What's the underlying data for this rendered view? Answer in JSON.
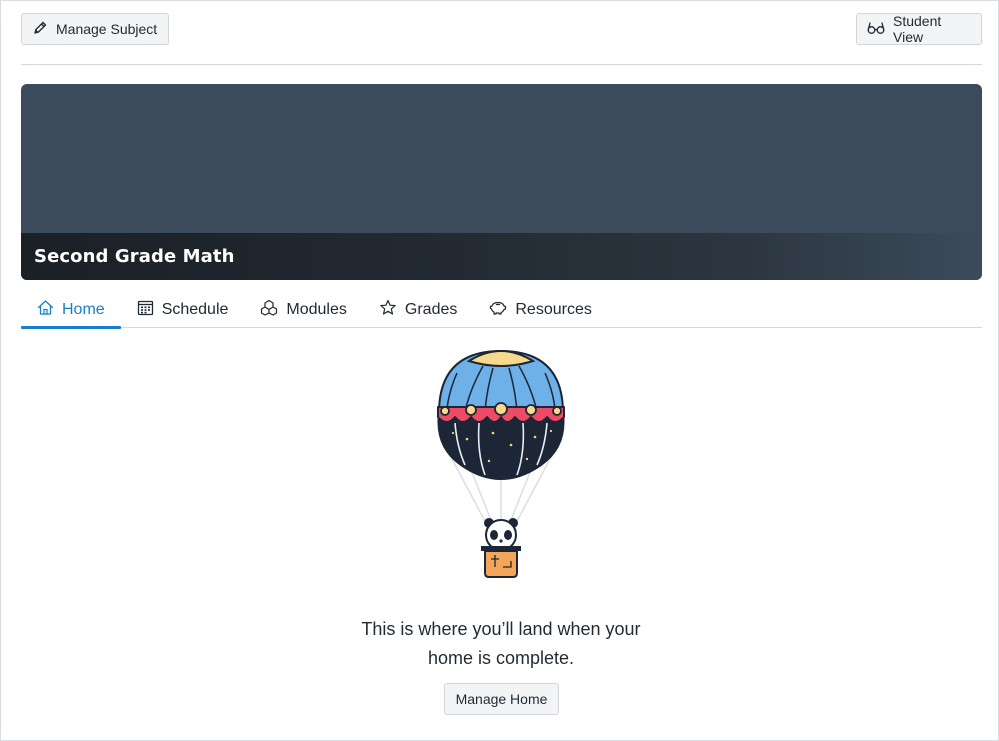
{
  "toolbar": {
    "manage_subject_label": "Manage Subject",
    "student_view_label": "Student View"
  },
  "banner": {
    "title": "Second Grade Math",
    "background_color": "#3b4b5b"
  },
  "tabs": [
    {
      "label": "Home",
      "icon": "home-icon",
      "active": true
    },
    {
      "label": "Schedule",
      "icon": "calendar-icon",
      "active": false
    },
    {
      "label": "Modules",
      "icon": "modules-icon",
      "active": false
    },
    {
      "label": "Grades",
      "icon": "star-icon",
      "active": false
    },
    {
      "label": "Resources",
      "icon": "piggy-bank-icon",
      "active": false
    }
  ],
  "empty_state": {
    "illustration": "hot-air-balloon-panda",
    "message_line1": "This is where you’ll land when your",
    "message_line2": "home is complete.",
    "manage_home_label": "Manage Home"
  },
  "colors": {
    "accent": "#1a7fc9",
    "text": "#1f2933"
  }
}
